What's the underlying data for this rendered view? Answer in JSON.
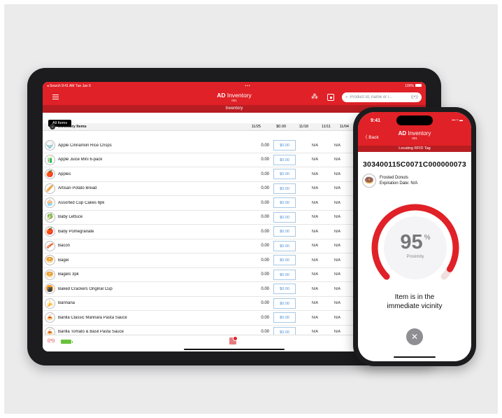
{
  "ipad": {
    "status": {
      "left": "◂ Search  9:41 AM  Tue Jan 9",
      "center": "•••",
      "right": "100%"
    },
    "nav": {
      "title_bold": "AD",
      "title_rest": " Inventory",
      "subtitle": "001",
      "search_placeholder": "Product Id, name or l...",
      "rfid_chip": "((•))"
    },
    "tab_title": "Inventory",
    "filter_pill": "All Items",
    "table": {
      "header_name": "Inventory Items",
      "columns": [
        "11/25",
        "$0.00",
        "11/18",
        "11/11",
        "11/04"
      ],
      "rows": [
        {
          "icon": "🍚",
          "name": "Apple Cinnamon Rice Crisps",
          "qty": "0.00",
          "price": "$0.00",
          "a": "N/A",
          "b": "N/A"
        },
        {
          "icon": "🧃",
          "name": "Apple Juice Mini 6-pack",
          "qty": "0.00",
          "price": "$0.00",
          "a": "N/A",
          "b": "N/A"
        },
        {
          "icon": "🍎",
          "name": "Apples",
          "qty": "0.00",
          "price": "$0.00",
          "a": "N/A",
          "b": "N/A"
        },
        {
          "icon": "🥖",
          "name": "Artisan Potato Bread",
          "qty": "0.00",
          "price": "$0.00",
          "a": "N/A",
          "b": "N/A"
        },
        {
          "icon": "🧁",
          "name": "Assorted Cup Cakes 6pk",
          "qty": "0.00",
          "price": "$0.00",
          "a": "N/A",
          "b": "N/A"
        },
        {
          "icon": "🥬",
          "name": "Baby Lettuce",
          "qty": "0.00",
          "price": "$0.00",
          "a": "N/A",
          "b": "N/A"
        },
        {
          "icon": "🍎",
          "name": "Baby Pomegranate",
          "qty": "0.00",
          "price": "$0.00",
          "a": "N/A",
          "b": "N/A"
        },
        {
          "icon": "🥓",
          "name": "Bacon",
          "qty": "0.00",
          "price": "$0.00",
          "a": "N/A",
          "b": "N/A"
        },
        {
          "icon": "🥯",
          "name": "Bagel",
          "qty": "0.00",
          "price": "$0.00",
          "a": "N/A",
          "b": "N/A"
        },
        {
          "icon": "🥯",
          "name": "Bagels 3pk",
          "qty": "0.00",
          "price": "$0.00",
          "a": "N/A",
          "b": "N/A"
        },
        {
          "icon": "🍘",
          "name": "Baked Crackers Original Cup",
          "qty": "0.00",
          "price": "$0.00",
          "a": "N/A",
          "b": "N/A"
        },
        {
          "icon": "🍌",
          "name": "Bannana",
          "qty": "0.00",
          "price": "$0.00",
          "a": "N/A",
          "b": "N/A"
        },
        {
          "icon": "🍝",
          "name": "Barilla Classic Marinara Pasta Sauce",
          "qty": "0.00",
          "price": "$0.00",
          "a": "N/A",
          "b": "N/A"
        },
        {
          "icon": "🍝",
          "name": "Barilla Tomato & Basil Pasta Sauce",
          "qty": "0.00",
          "price": "$0.00",
          "a": "N/A",
          "b": "N/A"
        }
      ]
    },
    "footer": {
      "rfid_icon": "((•))"
    }
  },
  "iphone": {
    "time": "9:41",
    "status_icons": "▪▪▪ ≈ ▬",
    "back_label": "〈 Back",
    "title_bold": "AD",
    "title_rest": " Inventory",
    "subtitle": "001",
    "section_title": "Locating RFID Tag",
    "tag_id": "303400115C0071C000000073",
    "item_name": "Frosted Donuts",
    "expiration": "Expiration Date: N/A",
    "item_icon": "🍩",
    "proximity_value": "95",
    "proximity_unit": "%",
    "proximity_fraction": 0.95,
    "proximity_label": "Proximity",
    "message_line1": "Item is in the",
    "message_line2": "immediate vicinity",
    "close_glyph": "✕"
  },
  "colors": {
    "brand_red": "#e02127",
    "brand_dark_red": "#b81d22",
    "price_blue": "#4a90d9",
    "battery_green": "#6ac23c"
  }
}
